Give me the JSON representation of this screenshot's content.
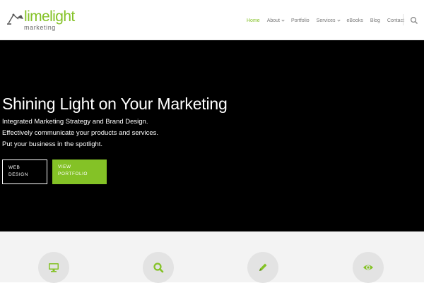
{
  "header": {
    "logo": {
      "name": "limelight",
      "sub": "marketing"
    },
    "nav": [
      {
        "label": "Home",
        "active": true,
        "dropdown": false
      },
      {
        "label": "About",
        "active": false,
        "dropdown": true
      },
      {
        "label": "Portfolio",
        "active": false,
        "dropdown": false
      },
      {
        "label": "Services",
        "active": false,
        "dropdown": true
      },
      {
        "label": "eBooks",
        "active": false,
        "dropdown": false
      },
      {
        "label": "Blog",
        "active": false,
        "dropdown": false
      },
      {
        "label": "Contact",
        "active": false,
        "dropdown": false
      }
    ],
    "search_icon": "search-icon"
  },
  "hero": {
    "title": "Shining Light on Your Marketing",
    "lines": [
      "Integrated Marketing Strategy and Brand Design.",
      "Effectively communicate your products and services.",
      "Put your business in the spotlight."
    ],
    "buttons": {
      "primary": {
        "line1": "WEB",
        "line2": "DESIGN"
      },
      "secondary": {
        "line1": "VIEW",
        "line2": "PORTFOLIO"
      }
    }
  },
  "features": [
    {
      "icon": "monitor-icon"
    },
    {
      "icon": "search-icon"
    },
    {
      "icon": "pencil-icon"
    },
    {
      "icon": "eye-icon"
    }
  ],
  "colors": {
    "accent": "#84c226",
    "hero_bg": "#000000",
    "text_muted": "#777777",
    "circle_bg": "#e3e3e3"
  }
}
